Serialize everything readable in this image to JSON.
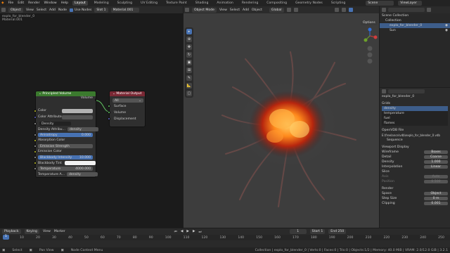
{
  "topbar": {
    "menus": [
      "File",
      "Edit",
      "Render",
      "Window",
      "Help"
    ],
    "workspaces": [
      "Layout",
      "Modeling",
      "Sculpting",
      "UV Editing",
      "Texture Paint",
      "Shading",
      "Animation",
      "Rendering",
      "Compositing",
      "Geometry Nodes",
      "Scripting"
    ],
    "active_workspace": "Layout",
    "scene": "Scene",
    "view_layer": "ViewLayer"
  },
  "node_editor": {
    "mode": "Object",
    "menus": [
      "View",
      "Select",
      "Add",
      "Node"
    ],
    "use_nodes": "Use Nodes",
    "slot": "Slot 1",
    "material": "Material.001",
    "breadcrumb": "explo_for_blender_0",
    "breadcrumb2": "Material.001",
    "principled": {
      "title": "Principled Volume",
      "out": "Volume",
      "rows": {
        "color": "Color",
        "color_attr": "Color Attribute",
        "density": "Density",
        "density_attr": "Density Attribu...",
        "density_attr_val": "density",
        "anisotropy": "Anisotropy",
        "anisotropy_val": "0.000",
        "abs_color": "Absorption Color",
        "em_strength": "Emission Strength",
        "em_color": "Emission Color",
        "bb_intensity": "Blackbody Intensity",
        "bb_intensity_val": "10.000",
        "bb_tint": "Blackbody Tint",
        "temperature": "Temperature",
        "temperature_val": "4000.000",
        "temp_attr": "Temperature A...",
        "temp_attr_val": "density"
      }
    },
    "output": {
      "title": "Material Output",
      "target": "All",
      "surface": "Surface",
      "volume": "Volume",
      "displacement": "Displacement"
    }
  },
  "viewport": {
    "mode": "Object Mode",
    "menus": [
      "View",
      "Select",
      "Add",
      "Object"
    ],
    "transform": "Global",
    "options": "Options"
  },
  "outliner": {
    "title": "Scene Collection",
    "items": [
      "Collection",
      "explo_for_blender_0",
      "Sun"
    ]
  },
  "properties": {
    "object": "explo_for_blender_0",
    "grids_label": "Grids",
    "grids": [
      "density",
      "temperature",
      "fuel",
      "flames"
    ],
    "opendb_label": "OpenVDB File",
    "path": "E:\\freelance\\vdb\\explo_for_blender_0.vdb",
    "sequence": "Sequence",
    "viewport_display": "Viewport Display",
    "wireframe": "Wireframe",
    "wireframe_val": "Boxes",
    "detail": "Detail",
    "detail_val": "Coarse",
    "density": "Density",
    "density_val": "1.000",
    "interp": "Interpolation",
    "interp_val": "Linear",
    "slice": "Slice",
    "axis": "Axis",
    "axis_val": "Auto",
    "position": "Position",
    "position_val": "0.500",
    "render": "Render",
    "space": "Space",
    "space_val": "Object",
    "step": "Step Size",
    "step_val": "0 m",
    "clipping": "Clipping",
    "clipping_val": "0.001"
  },
  "timeline": {
    "menus": [
      "Playback",
      "Keying",
      "View",
      "Marker"
    ],
    "current": "1",
    "start_label": "Start",
    "start": "1",
    "end_label": "End",
    "end": "250",
    "ticks": [
      "0",
      "10",
      "20",
      "30",
      "40",
      "50",
      "60",
      "70",
      "80",
      "90",
      "100",
      "110",
      "120",
      "130",
      "140",
      "150",
      "160",
      "170",
      "180",
      "190",
      "200",
      "210",
      "220",
      "230",
      "240",
      "250"
    ]
  },
  "status": {
    "left": "Select",
    "mid": "Pan View",
    "right": "Node Context Menu",
    "info": "Collection | explo_for_blender_0 | Verts:0 | Faces:0 | Tris:0 | Objects:1/2 | Memory: 40.0 MiB | VRAM: 2.0/12.0 GiB | 3.2.1"
  },
  "colors": {
    "accent": "#4772b3",
    "shader_node": "#3b7a2e",
    "output_node": "#7a2834"
  }
}
